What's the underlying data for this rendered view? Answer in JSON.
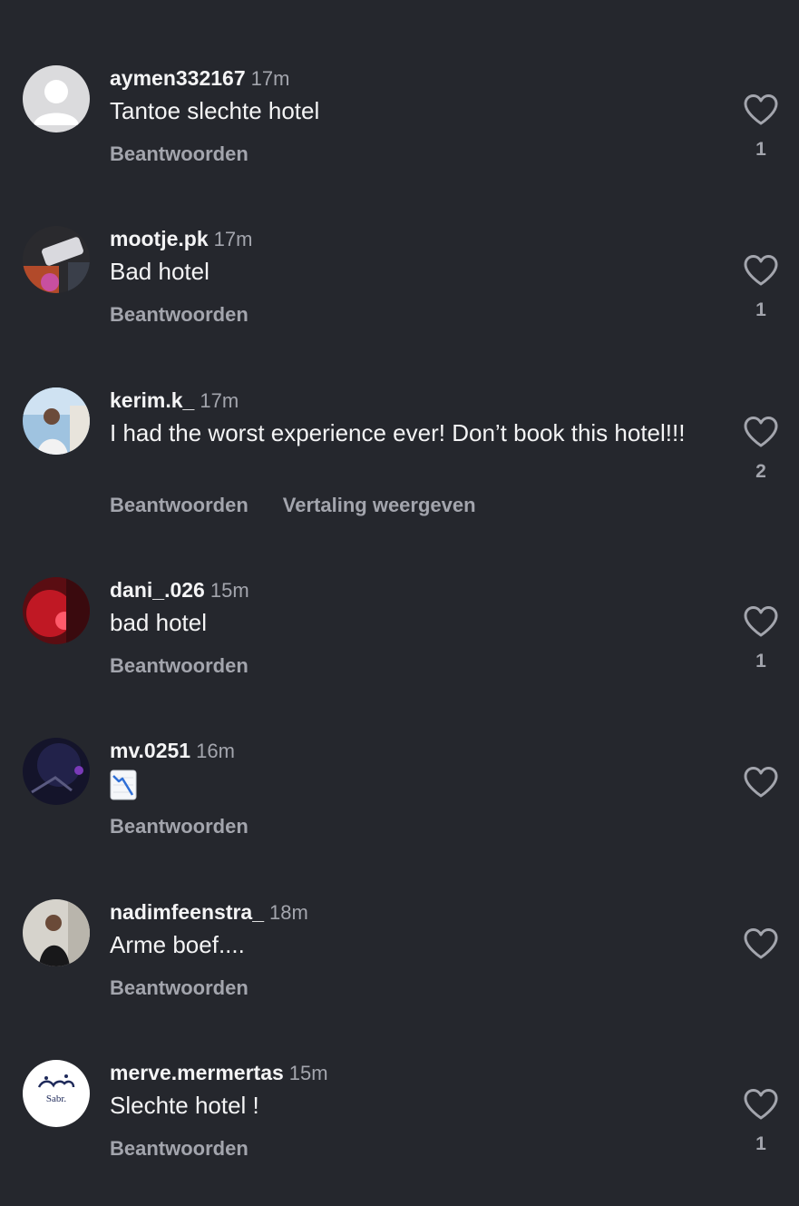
{
  "comments": [
    {
      "username": "aymen332167",
      "time": "17m",
      "text": "Tantoe slechte hotel",
      "reply": "Beantwoorden",
      "likes": "1",
      "avatar_icon": "default-user-avatar"
    },
    {
      "username": "mootje.pk",
      "time": "17m",
      "text": "Bad hotel",
      "reply": "Beantwoorden",
      "likes": "1",
      "avatar_icon": "photo-avatar"
    },
    {
      "username": "kerim.k_",
      "time": "17m",
      "text": "I had the worst experience ever! Don’t book this hotel!!!",
      "reply": "Beantwoorden",
      "translate": "Vertaling weergeven",
      "likes": "2",
      "avatar_icon": "photo-avatar"
    },
    {
      "username": "dani_.026",
      "time": "15m",
      "text": "bad hotel",
      "reply": "Beantwoorden",
      "likes": "1",
      "avatar_icon": "photo-avatar"
    },
    {
      "username": "mv.0251",
      "time": "16m",
      "text": "",
      "emoji": "chart-decreasing-emoji",
      "reply": "Beantwoorden",
      "likes": "",
      "avatar_icon": "photo-avatar"
    },
    {
      "username": "nadimfeenstra_",
      "time": "18m",
      "text": "Arme boef....",
      "reply": "Beantwoorden",
      "likes": "",
      "avatar_icon": "photo-avatar"
    },
    {
      "username": "merve.mermertas",
      "time": "15m",
      "text": "Slechte hotel !",
      "reply": "Beantwoorden",
      "likes": "1",
      "avatar_icon": "logo-avatar",
      "avatar_logo_text": "Sabr."
    }
  ],
  "colors": {
    "background": "#25272d",
    "primary_text": "#f4f4f5",
    "secondary_text": "#a3a5ad"
  }
}
